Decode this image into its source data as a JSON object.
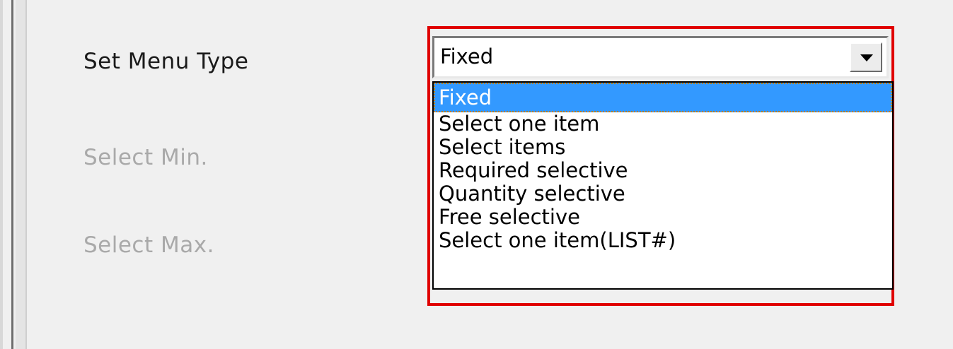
{
  "form": {
    "set_menu_type_label": "Set Menu Type",
    "select_min_label": "Select Min.",
    "select_max_label": "Select Max."
  },
  "combo": {
    "selected_value": "Fixed",
    "options": [
      "Fixed",
      "Select one item",
      "Select items",
      "Required selective",
      "Quantity selective",
      "Free selective",
      "Select one item(LIST#)"
    ]
  },
  "colors": {
    "highlight_border": "#e00000",
    "selection_background": "#3399ff"
  },
  "icons": {
    "dropdown_button": "chevron-down-icon"
  }
}
